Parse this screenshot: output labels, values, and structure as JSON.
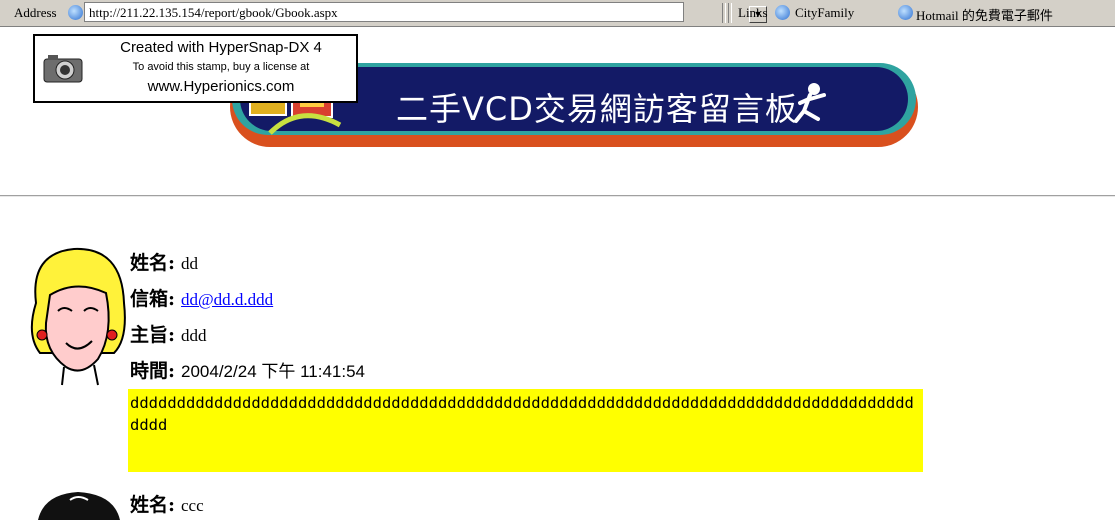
{
  "browser": {
    "address_label": "Address",
    "url": "http://211.22.135.154/report/gbook/Gbook.aspx",
    "links_label": "Links",
    "links": [
      {
        "label": "CityFamily",
        "icon": "ie-page-icon"
      },
      {
        "label": "Hotmail 的免費電子郵件",
        "icon": "ie-page-icon"
      }
    ]
  },
  "stamp": {
    "line1": "Created with HyperSnap-DX 4",
    "line2": "To avoid this stamp, buy a license at",
    "line3": "www.Hyperionics.com"
  },
  "banner": {
    "title": "二手VCD交易網訪客留言板",
    "colors": {
      "navy": "#131a66",
      "orange": "#d9501e",
      "teal": "#2fa3a0"
    }
  },
  "entries": [
    {
      "avatar": "blonde-woman-avatar",
      "name_label": "姓名:",
      "name": "dd",
      "email_label": "信箱:",
      "email": "dd@dd.d.ddd",
      "subject_label": "主旨:",
      "subject": "ddd",
      "time_label": "時間:",
      "time": "2004/2/24 下午 11:41:54",
      "message": "dddddddddddddddddddddddddddddddddddddddddddddddddddddddddddddddddddddddddddddddddddddddd",
      "message_bg": "#ffff00"
    },
    {
      "avatar": "dark-hair-avatar",
      "name_label": "姓名:",
      "name": "ccc"
    }
  ]
}
